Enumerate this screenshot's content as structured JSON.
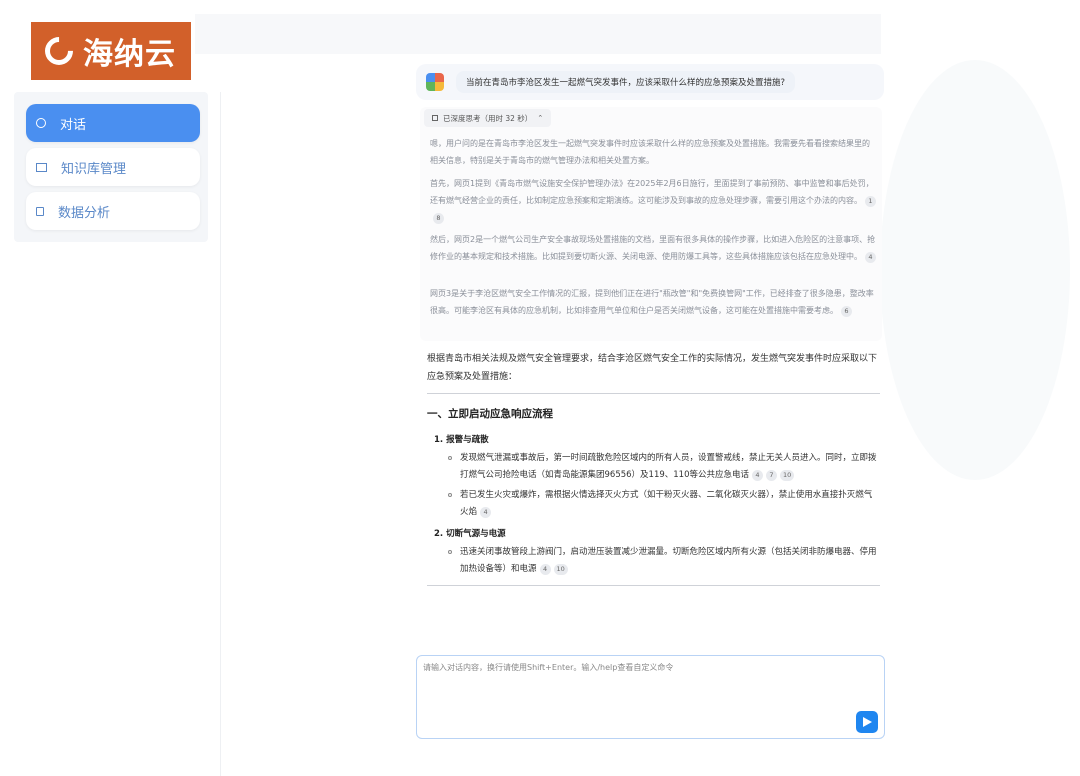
{
  "brand": {
    "name": "海纳云"
  },
  "sidebar": {
    "items": [
      {
        "label": "对话",
        "icon": "chat-bubble-icon",
        "active": true
      },
      {
        "label": "知识库管理",
        "icon": "book-icon",
        "active": false
      },
      {
        "label": "数据分析",
        "icon": "chart-icon",
        "active": false
      }
    ]
  },
  "chat": {
    "question": "当前在青岛市李沧区发生一起燃气突发事件，应该采取什么样的应急预案及处置措施?",
    "thinking": {
      "toggle_label": "已深度思考（用时 32 秒）",
      "paragraphs": [
        {
          "text": "嗯，用户问的是在青岛市李沧区发生一起燃气突发事件时应该采取什么样的应急预案及处置措施。我需要先看看搜索结果里的相关信息，特别是关于青岛市的燃气管理办法和相关处置方案。",
          "cites": []
        },
        {
          "text": "首先，网页1提到《青岛市燃气设施安全保护管理办法》在2025年2月6日施行，里面提到了事前预防、事中监管和事后处罚，还有燃气经营企业的责任，比如制定应急预案和定期演练。这可能涉及到事故的应急处理步骤，需要引用这个办法的内容。",
          "cites": [
            "1",
            "8"
          ]
        },
        {
          "text": "然后，网页2是一个燃气公司生产安全事故现场处置措施的文档，里面有很多具体的操作步骤，比如进入危险区的注意事项、抢修作业的基本规定和技术措施。比如提到要切断火源、关闭电源、使用防爆工具等，这些具体措施应该包括在应急处理中。",
          "cites": [
            "4"
          ]
        },
        {
          "text": "网页3是关于李沧区燃气安全工作情况的汇报，提到他们正在进行\"瓶改管\"和\"免费换管网\"工作，已经排查了很多隐患，整改率很高。可能李沧区有具体的应急机制，比如排查用气单位和住户是否关闭燃气设备，这可能在处置措施中需要考虑。",
          "cites": [
            "6"
          ]
        }
      ]
    },
    "answer": {
      "intro": "根据青岛市相关法规及燃气安全管理要求，结合李沧区燃气安全工作的实际情况，发生燃气突发事件时应采取以下应急预案及处置措施：",
      "section_title": "一、立即启动应急响应流程",
      "items": [
        {
          "title": "1. 报警与疏散",
          "bullets": [
            {
              "text": "发现燃气泄漏或事故后，第一时间疏散危险区域内的所有人员，设置警戒线，禁止无关人员进入。同时，立即拨打燃气公司抢险电话（如青岛能源集团96556）及119、110等公共应急电话",
              "cites": [
                "4",
                "7",
                "10"
              ]
            },
            {
              "text": "若已发生火灾或爆炸，需根据火情选择灭火方式（如干粉灭火器、二氧化碳灭火器），禁止使用水直接扑灭燃气火焰",
              "cites": [
                "4"
              ]
            }
          ]
        },
        {
          "title": "2. 切断气源与电源",
          "bullets": [
            {
              "text": "迅速关闭事故管段上游阀门，启动泄压装置减少泄漏量。切断危险区域内所有火源（包括关闭非防爆电器、停用加热设备等）和电源",
              "cites": [
                "4",
                "10"
              ]
            }
          ]
        }
      ]
    },
    "input": {
      "placeholder": "请输入对话内容，换行请使用Shift+Enter。输入/help查看自定义命令"
    }
  },
  "colors": {
    "brand": "#d2602a",
    "accent": "#4a8ff0",
    "send": "#1f86f0"
  }
}
